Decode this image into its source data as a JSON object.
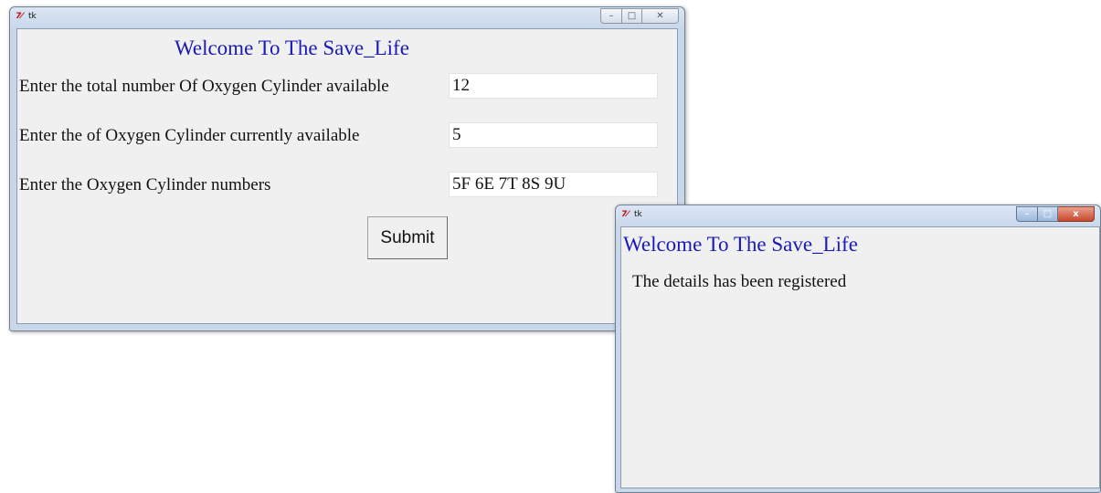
{
  "window1": {
    "title": "tk",
    "logo": "7⁄",
    "heading": "Welcome To The Save_Life",
    "fields": [
      {
        "label": "Enter the total number Of Oxygen Cylinder available",
        "value": "12"
      },
      {
        "label": "Enter the of Oxygen Cylinder currently available",
        "value": "5"
      },
      {
        "label": "Enter the Oxygen Cylinder numbers",
        "value": "5F 6E 7T 8S 9U"
      }
    ],
    "submit_label": "Submit",
    "buttons": {
      "minimize": "–",
      "maximize": "□",
      "close": "✕"
    }
  },
  "window2": {
    "title": "tk",
    "logo": "7⁄",
    "heading": "Welcome To The Save_Life",
    "message": "The details has been registered",
    "buttons": {
      "minimize": "–",
      "maximize": "□",
      "close": "x"
    }
  }
}
